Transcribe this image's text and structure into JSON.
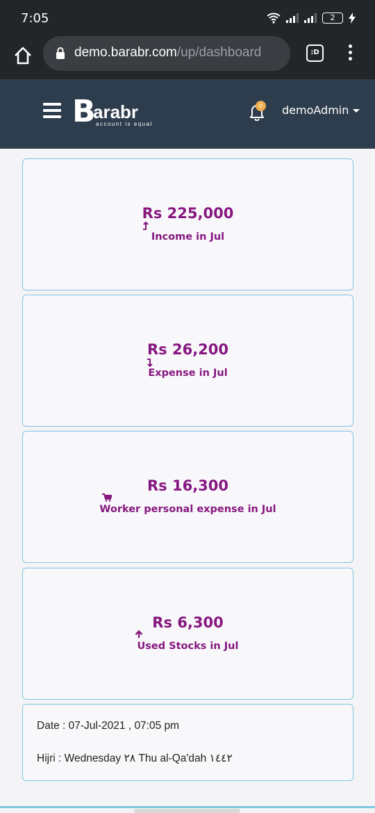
{
  "status_bar": {
    "time": "7:05",
    "battery": "2"
  },
  "browser": {
    "url_domain": "demo.barabr.com",
    "url_path": "/up/dashboard",
    "tab_label": ":D"
  },
  "app_header": {
    "logo_letter": "B",
    "logo_word": "arabr",
    "logo_tagline": "account is equal",
    "notification_count": "0",
    "user_name": "demoAdmin"
  },
  "stats": [
    {
      "amount": "Rs 225,000",
      "label": "Income in Jul",
      "icon": "trend-up-icon"
    },
    {
      "amount": "Rs 26,200",
      "label": "Expense in Jul",
      "icon": "trend-down-icon"
    },
    {
      "amount": "Rs 16,300",
      "label": "Worker personal expense in Jul",
      "icon": "cart-icon"
    },
    {
      "amount": "Rs 6,300",
      "label": "Used Stocks in Jul",
      "icon": "arrow-up-icon"
    }
  ],
  "info": {
    "date": "Date : 07-Jul-2021 , 07:05 pm",
    "hijri": "Hijri : Wednesday ٢٨ Thu al-Qa'dah ١٤٤٢"
  },
  "colors": {
    "header_bg": "#2e3d4d",
    "accent": "#86177f",
    "card_border": "#7fc6df",
    "badge": "#f0ad4e"
  }
}
